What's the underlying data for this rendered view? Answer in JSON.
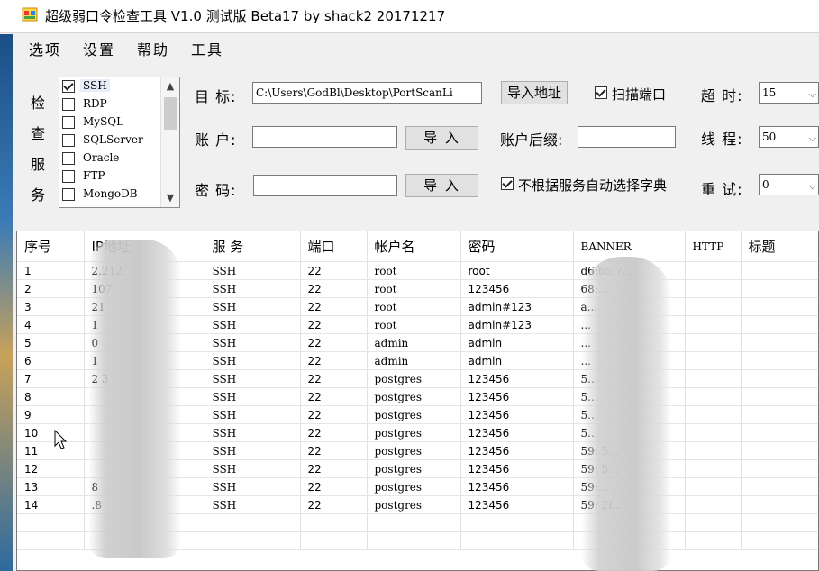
{
  "window": {
    "title": "超级弱口令检查工具 V1.0 测试版 Beta17 by shack2 20171217"
  },
  "menu": [
    "选项",
    "设置",
    "帮助",
    "工具"
  ],
  "services": {
    "caption": [
      "检",
      "查",
      "服",
      "务"
    ],
    "items": [
      {
        "label": "SSH",
        "checked": true
      },
      {
        "label": "RDP",
        "checked": false
      },
      {
        "label": "MySQL",
        "checked": false
      },
      {
        "label": "SQLServer",
        "checked": false
      },
      {
        "label": "Oracle",
        "checked": false
      },
      {
        "label": "FTP",
        "checked": false
      },
      {
        "label": "MongoDB",
        "checked": false
      }
    ]
  },
  "form": {
    "target_label": "目 标:",
    "target_value": "C:\\Users\\GodBl\\Desktop\\PortScanLi",
    "import_address_button": "导入地址",
    "scan_ports_label": "扫描端口",
    "scan_ports_checked": true,
    "timeout_label": "超 时:",
    "timeout_value": "15",
    "account_label": "账 户:",
    "account_value": "",
    "account_import_button": "导 入",
    "account_suffix_label": "账户后缀:",
    "account_suffix_value": "",
    "threads_label": "线 程:",
    "threads_value": "50",
    "password_label": "密 码:",
    "password_value": "",
    "password_import_button": "导 入",
    "auto_dict_label": "不根据服务自动选择字典",
    "auto_dict_checked": true,
    "retry_label": "重 试:",
    "retry_value": "0"
  },
  "table": {
    "columns": [
      "序号",
      "IP地址",
      "服 务",
      "端口",
      "帐户名",
      "密码",
      "BANNER",
      "HTTP",
      "标题"
    ],
    "rows": [
      [
        "1",
        "2.212",
        "SSH",
        "22",
        "root",
        "root",
        "d6:65:7...",
        "",
        ""
      ],
      [
        "2",
        "107",
        "SSH",
        "22",
        "root",
        "123456",
        "68:...",
        "",
        ""
      ],
      [
        "3",
        "21",
        "SSH",
        "22",
        "root",
        "admin#123",
        "a...",
        "",
        ""
      ],
      [
        "4",
        "1",
        "SSH",
        "22",
        "root",
        "admin#123",
        "...",
        "",
        ""
      ],
      [
        "5",
        "0",
        "SSH",
        "22",
        "admin",
        "admin",
        "...",
        "",
        ""
      ],
      [
        "6",
        "1",
        "SSH",
        "22",
        "admin",
        "admin",
        "...",
        "",
        ""
      ],
      [
        "7",
        "2 3",
        "SSH",
        "22",
        "postgres",
        "123456",
        "5...",
        "",
        ""
      ],
      [
        "8",
        "",
        "SSH",
        "22",
        "postgres",
        "123456",
        "5...",
        "",
        ""
      ],
      [
        "9",
        "",
        "SSH",
        "22",
        "postgres",
        "123456",
        "5...",
        "",
        ""
      ],
      [
        "10",
        "",
        "SSH",
        "22",
        "postgres",
        "123456",
        "5...",
        "",
        ""
      ],
      [
        "11",
        "",
        "SSH",
        "22",
        "postgres",
        "123456",
        "59: 5...",
        "",
        ""
      ],
      [
        "12",
        "",
        "SSH",
        "22",
        "postgres",
        "123456",
        "59: 5...",
        "",
        ""
      ],
      [
        "13",
        "8",
        "SSH",
        "22",
        "postgres",
        "123456",
        "59:...",
        "",
        ""
      ],
      [
        "14",
        ".8",
        "SSH",
        "22",
        "postgres",
        "123456",
        "59: 2f...",
        "",
        ""
      ]
    ]
  }
}
